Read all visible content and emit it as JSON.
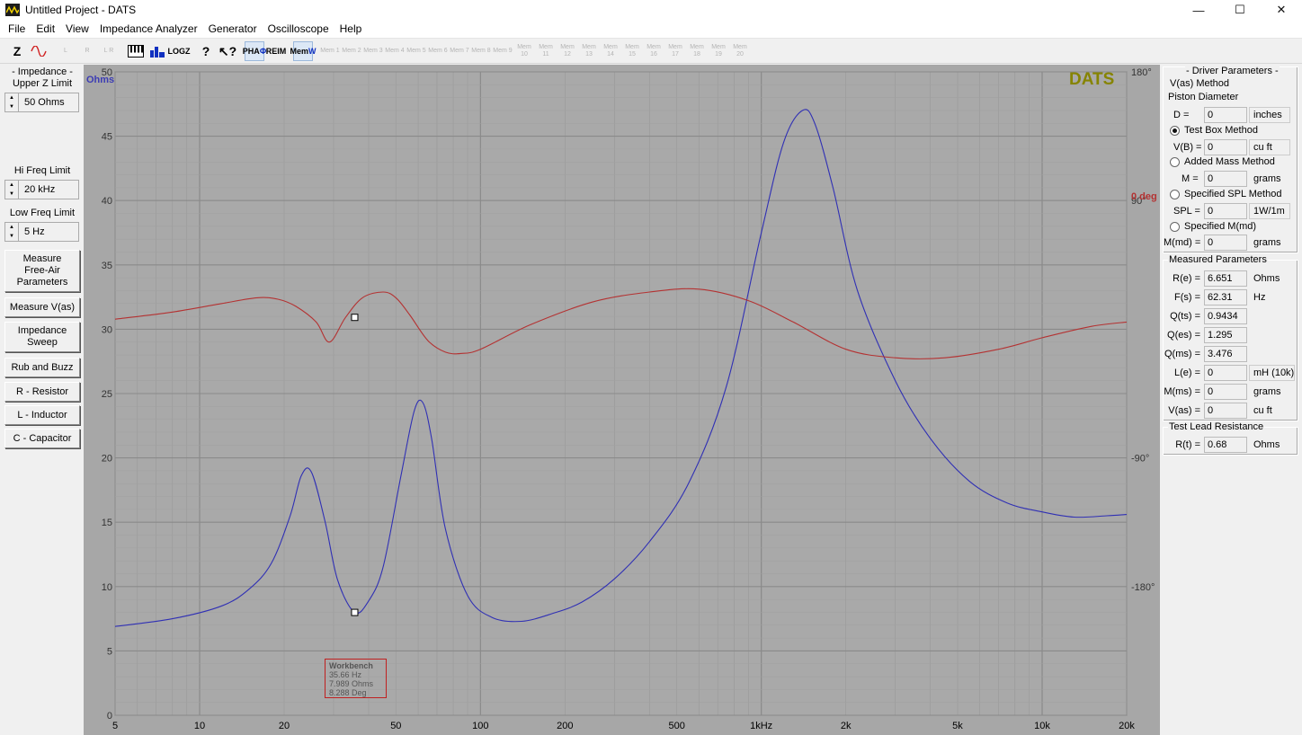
{
  "window": {
    "title": "Untitled Project - DATS",
    "minimize": "—",
    "maximize": "☐",
    "close": "✕"
  },
  "menu": [
    "File",
    "Edit",
    "View",
    "Impedance Analyzer",
    "Generator",
    "Oscilloscope",
    "Help"
  ],
  "toolbar": {
    "z": "Z",
    "log": "LOG",
    "log_sub": "Z",
    "pha": "PHA",
    "pha_sub": "Φ",
    "re": "RE",
    "re_sub": "IM",
    "mem": "Mem",
    "mem_sub": "W",
    "mem_slots": [
      "Mem 1",
      "Mem 2",
      "Mem 3",
      "Mem 4",
      "Mem 5",
      "Mem 6",
      "Mem 7",
      "Mem 8",
      "Mem 9",
      "Mem 10",
      "Mem 11",
      "Mem 12",
      "Mem 13",
      "Mem 14",
      "Mem 15",
      "Mem 16",
      "Mem 17",
      "Mem 18",
      "Mem 19",
      "Mem 20"
    ]
  },
  "left": {
    "impedance_title": "- Impedance -",
    "upper_z_label": "Upper Z Limit",
    "upper_z_value": "50 Ohms",
    "hi_freq_label": "Hi Freq Limit",
    "hi_freq_value": "20 kHz",
    "low_freq_label": "Low Freq Limit",
    "low_freq_value": "5 Hz",
    "buttons": {
      "measure_free_air": "Measure Free-Air Parameters",
      "measure_vas": "Measure V(as)",
      "impedance_sweep": "Impedance Sweep",
      "rub_buzz": "Rub and Buzz",
      "r_resistor": "R - Resistor",
      "l_inductor": "L - Inductor",
      "c_capacitor": "C - Capacitor"
    }
  },
  "chart_data": {
    "type": "line",
    "logo": "DATS",
    "ylabel_left": "Ohms",
    "ylabel_right": "0 deg",
    "xscale": "log",
    "xlim": [
      5,
      20000
    ],
    "ylim": [
      0,
      50
    ],
    "ylim_right": [
      -270,
      180
    ],
    "grid": true,
    "x_ticks": [
      "5",
      "10",
      "20",
      "50",
      "100",
      "200",
      "500",
      "1kHz",
      "2k",
      "5k",
      "10k",
      "20k"
    ],
    "x_tick_values": [
      5,
      10,
      20,
      50,
      100,
      200,
      500,
      1000,
      2000,
      5000,
      10000,
      20000
    ],
    "y_ticks_left": [
      "0",
      "5",
      "10",
      "15",
      "20",
      "25",
      "30",
      "35",
      "40",
      "45",
      "50"
    ],
    "y_ticks_right": [
      "180°",
      "90°",
      "-90°",
      "-180°"
    ],
    "y_tick_values_right": [
      180,
      90,
      -90,
      -180
    ],
    "series": [
      {
        "color": "#3030b4",
        "axis": "left",
        "x": [
          5,
          8,
          12,
          15,
          18,
          21,
          23,
          25,
          28,
          31,
          35.66,
          40,
          45,
          52,
          58,
          62.3,
          67,
          75,
          90,
          110,
          140,
          180,
          230,
          300,
          400,
          550,
          750,
          1000,
          1200,
          1400,
          1550,
          1800,
          2200,
          3000,
          4000,
          5500,
          7500,
          10000,
          13000,
          17000,
          20000
        ],
        "y": [
          6.9,
          7.5,
          8.5,
          9.8,
          11.8,
          15.5,
          18.6,
          18.9,
          15.0,
          10.5,
          7.99,
          8.9,
          11.5,
          18.5,
          23.6,
          24.3,
          21.5,
          14.5,
          9.3,
          7.6,
          7.3,
          7.9,
          8.8,
          10.6,
          13.5,
          18.0,
          25.5,
          37.5,
          44.5,
          47.0,
          46.0,
          41.0,
          33.0,
          26.0,
          21.5,
          18.2,
          16.5,
          15.8,
          15.4,
          15.5,
          15.6
        ]
      },
      {
        "color": "#b43232",
        "axis": "right",
        "x": [
          5,
          8,
          12,
          16,
          19,
          22,
          26,
          29,
          33,
          38,
          45,
          50,
          56,
          65,
          75,
          85,
          100,
          150,
          250,
          400,
          600,
          900,
          1300,
          2000,
          3000,
          4500,
          7000,
          10000,
          15000,
          20000
        ],
        "y": [
          7,
          12,
          18,
          22,
          21,
          16,
          5,
          -9,
          8,
          22,
          26,
          22,
          10,
          -8,
          -16,
          -17,
          -14,
          3,
          19,
          26,
          28,
          20,
          5,
          -14,
          -20,
          -20,
          -14,
          -6,
          2,
          5
        ]
      }
    ],
    "workbench": {
      "title": "Workbench",
      "freq": "35.66 Hz",
      "ohms": "7.989 Ohms",
      "deg": "8.288 Deg"
    },
    "markers": [
      {
        "x": 35.66,
        "y": 7.989,
        "axis": "left"
      },
      {
        "x": 35.66,
        "y": 8.288,
        "axis": "right"
      }
    ]
  },
  "right": {
    "driver_title": "- Driver Parameters -",
    "vas_method": "V(as) Method",
    "piston_diameter": "Piston Diameter",
    "d_label": "D =",
    "d_value": "0",
    "d_unit": "inches",
    "test_box": "Test Box Method",
    "vb_label": "V(B) =",
    "vb_value": "0",
    "vb_unit": "cu ft",
    "added_mass": "Added Mass Method",
    "m_label": "M =",
    "m_value": "0",
    "m_unit": "grams",
    "spl_method": "Specified SPL Method",
    "spl_label": "SPL =",
    "spl_value": "0",
    "spl_unit": "1W/1m",
    "mmd_method": "Specified M(md)",
    "mmd_label": "M(md) =",
    "mmd_value": "0",
    "mmd_unit": "grams",
    "measured_title": "Measured Parameters",
    "measured": [
      {
        "label": "R(e) =",
        "value": "6.651",
        "unit": "Ohms"
      },
      {
        "label": "F(s) =",
        "value": "62.31",
        "unit": "Hz"
      },
      {
        "label": "Q(ts) =",
        "value": "0.9434",
        "unit": ""
      },
      {
        "label": "Q(es) =",
        "value": "1.295",
        "unit": ""
      },
      {
        "label": "Q(ms) =",
        "value": "3.476",
        "unit": ""
      },
      {
        "label": "L(e) =",
        "value": "0",
        "unit": "mH (10k)"
      },
      {
        "label": "M(ms) =",
        "value": "0",
        "unit": "grams"
      },
      {
        "label": "V(as) =",
        "value": "0",
        "unit": "cu ft"
      }
    ],
    "lead_title": "Test Lead Resistance",
    "rt_label": "R(t) =",
    "rt_value": "0.68",
    "rt_unit": "Ohms"
  }
}
